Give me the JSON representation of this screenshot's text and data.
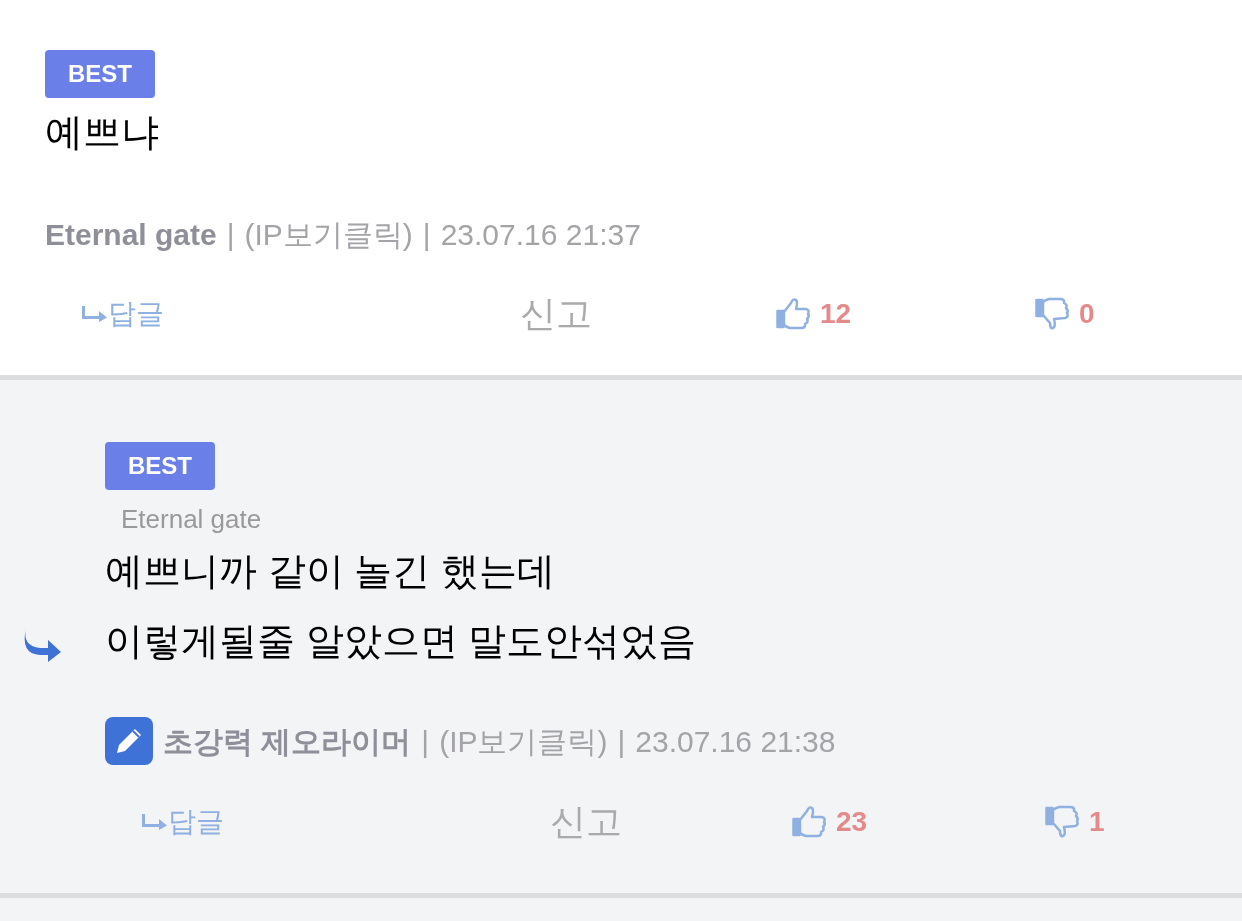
{
  "comments": [
    {
      "kind": "comment",
      "badge": "BEST",
      "body": [
        "예쁘냐"
      ],
      "author": "Eternal gate",
      "is_writer": false,
      "separator": "|",
      "ip": "(IP보기클릭)",
      "date": "23.07.16 21:37",
      "reply_label": "답글",
      "report": "신고",
      "likes": "12",
      "dislikes": "0"
    },
    {
      "kind": "reply",
      "badge": "BEST",
      "reply_to": "Eternal gate",
      "body": [
        "예쁘니까 같이 놀긴 했는데",
        "이렇게될줄 알았으면 말도안섞었음"
      ],
      "author": "초강력 제오라이머",
      "is_writer": true,
      "separator": "|",
      "ip": "(IP보기클릭)",
      "date": "23.07.16 21:38",
      "reply_label": "답글",
      "report": "신고",
      "likes": "23",
      "dislikes": "1"
    }
  ]
}
